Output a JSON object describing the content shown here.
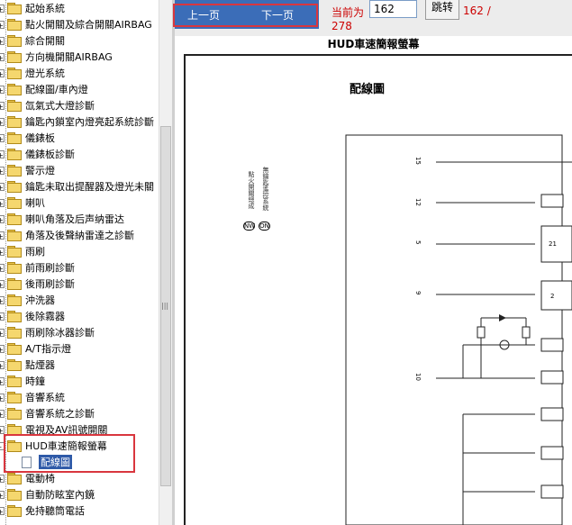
{
  "tree": {
    "items": [
      {
        "label": "起始系統"
      },
      {
        "label": "點火開關及綜合開關AIRBAG"
      },
      {
        "label": "綜合開關"
      },
      {
        "label": "方向機開關AIRBAG"
      },
      {
        "label": "燈光系統"
      },
      {
        "label": "配線圖/車內燈"
      },
      {
        "label": "氙氣式大燈診斷"
      },
      {
        "label": "鑰匙內鎖室內燈亮起系統診斷"
      },
      {
        "label": "儀錶板"
      },
      {
        "label": "儀錶板診斷"
      },
      {
        "label": "警示燈"
      },
      {
        "label": "鑰匙未取出提醒器及燈光未關"
      },
      {
        "label": "喇叭"
      },
      {
        "label": "喇叭角落及后声纳雷达"
      },
      {
        "label": "角落及後聲納雷達之診斷"
      },
      {
        "label": "雨刷"
      },
      {
        "label": "前雨刷診斷"
      },
      {
        "label": "後雨刷診斷"
      },
      {
        "label": "沖洗器"
      },
      {
        "label": "後除霧器"
      },
      {
        "label": "雨刷除冰器診斷"
      },
      {
        "label": "A/T指示燈"
      },
      {
        "label": "點煙器"
      },
      {
        "label": "時鐘"
      },
      {
        "label": "音響系統"
      },
      {
        "label": "音響系統之診斷"
      },
      {
        "label": "電視及AV訊號開關"
      },
      {
        "label": "HUD車速簡報螢幕"
      },
      {
        "label": "配線圖"
      },
      {
        "label": "電動椅"
      },
      {
        "label": "自動防眩室內鏡"
      },
      {
        "label": "免持聽筒電話"
      }
    ],
    "expand_symbol": "+",
    "collapse_symbol": "-"
  },
  "toolbar": {
    "prev": "上一页",
    "next": "下一页",
    "current_label": "当前为",
    "page_value": "162",
    "jump": "跳转",
    "page_count": "162 /",
    "total": "278"
  },
  "document": {
    "title": "HUD車速簡報螢幕",
    "heading": "配線圖",
    "pin_numbers": [
      "15",
      "12",
      "5",
      "9",
      "10"
    ],
    "connector_ids": [
      "21",
      "2"
    ],
    "legend": [
      "NW",
      "ON"
    ],
    "side_notes": [
      "點火開關總成",
      "無鑰匙遙控系統"
    ]
  },
  "colors": {
    "highlight": "#d9363e",
    "nav_bg": "#3b6db8",
    "page_text": "#cc0000"
  }
}
